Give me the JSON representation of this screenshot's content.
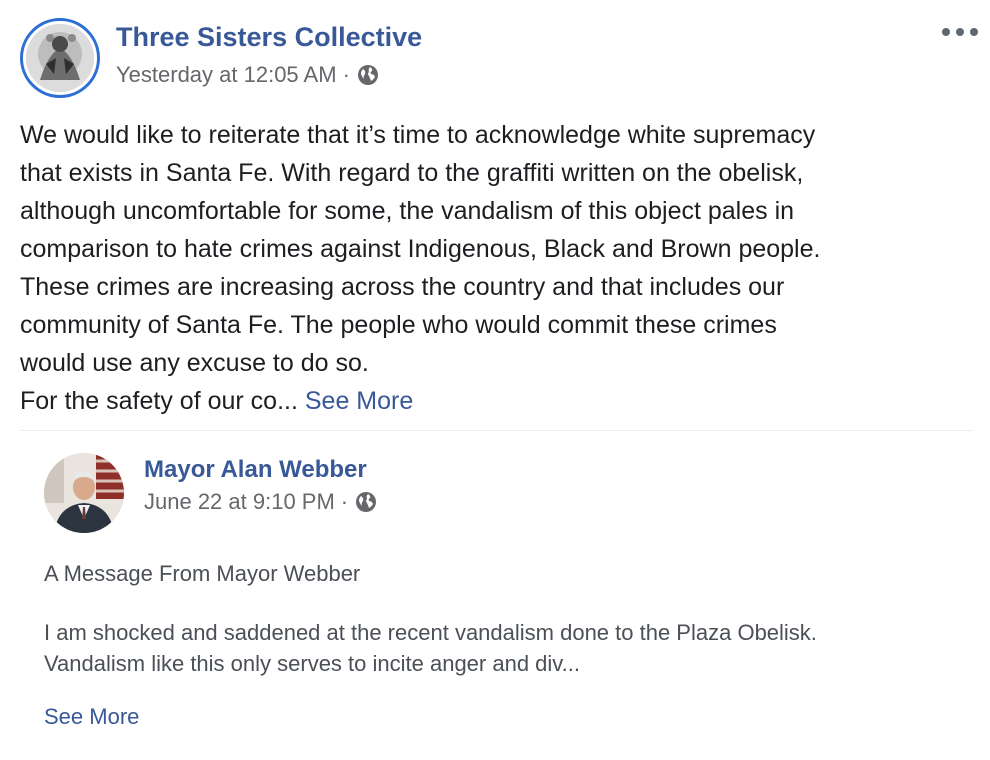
{
  "post": {
    "author": "Three Sisters Collective",
    "timestamp": "Yesterday at 12:05 AM",
    "separator": "·",
    "privacy_icon": "globe-icon",
    "menu_icon": "more-options-icon",
    "body_lines": [
      "We would like to reiterate that it’s time to acknowledge white supremacy",
      "that exists in Santa Fe. With regard to the graffiti written on the obelisk,",
      "although uncomfortable for some, the vandalism of this object pales in",
      "comparison to hate crimes against Indigenous, Black and Brown people.",
      "These crimes are increasing across the country and that includes our",
      "community of Santa Fe. The people who would commit these crimes",
      "would use any excuse to do so.",
      "For the safety of our co..."
    ],
    "see_more": "See More"
  },
  "shared_post": {
    "author": "Mayor Alan Webber",
    "timestamp": "June 22 at 9:10 PM",
    "separator": "·",
    "privacy_icon": "globe-icon",
    "title": "A Message From Mayor Webber",
    "body_lines": [
      "I am shocked and saddened at the recent vandalism done to the Plaza Obelisk.",
      "Vandalism like this only serves to incite anger and div..."
    ],
    "see_more": "See More"
  },
  "colors": {
    "link": "#385898",
    "meta": "#65676b",
    "avatar_ring": "#2d6fd6"
  }
}
